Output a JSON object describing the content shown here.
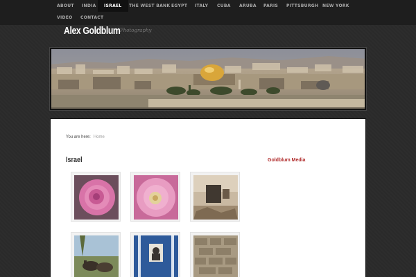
{
  "nav": {
    "items": [
      "ABOUT",
      "INDIA",
      "ISRAEL",
      "THE WEST BANK",
      "EGYPT",
      "ITALY",
      "CUBA",
      "ARUBA",
      "PARIS",
      "PITTSBURGH",
      "NEW YORK",
      "VIDEO",
      "CONTACT"
    ],
    "active": "ISRAEL"
  },
  "site": {
    "title": "Alex Goldblum",
    "tagline": "Photography"
  },
  "breadcrumb": {
    "prefix": "You are here:",
    "home": "Home"
  },
  "page": {
    "title": "Israel"
  },
  "sidebar": {
    "title": "Goldblum Media"
  },
  "gallery": [
    "pink-rose-photo",
    "pink-rose-closeup-photo",
    "ruined-interior-photo",
    "donkeys-photo",
    "blue-door-portrait-photo",
    "stone-wall-photo"
  ],
  "colors": {
    "accent": "#b02a2a",
    "background": "#2a2a2a",
    "nav_active": "#111111"
  }
}
